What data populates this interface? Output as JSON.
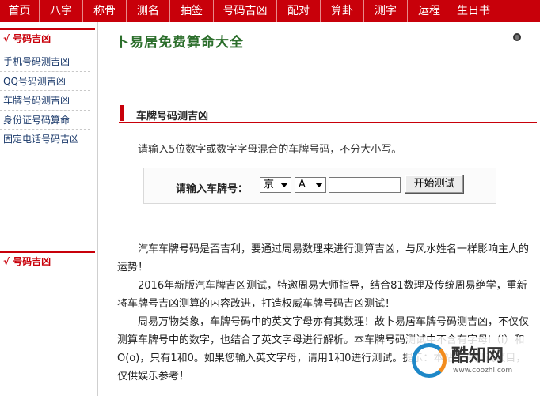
{
  "topnav": {
    "items": [
      "首页",
      "八字",
      "称骨",
      "测名",
      "抽签",
      "号码吉凶",
      "配对",
      "算卦",
      "测字",
      "运程",
      "生日书"
    ]
  },
  "sidebar": {
    "heading": "√ 号码吉凶",
    "items": [
      "手机号码测吉凶",
      "QQ号码测吉凶",
      "车牌号码测吉凶",
      "身份证号码算命",
      "固定电话号码吉凶"
    ],
    "second_heading": "√ 号码吉凶"
  },
  "main": {
    "site_title": "卜易居免费算命大全",
    "section_title": "车牌号码测吉凶",
    "instruction": "请输入5位数字或数字字母混合的车牌号码，不分大小写。",
    "form": {
      "label": "请输入车牌号：",
      "province_value": "京",
      "letter_value": "A",
      "plate_value": "",
      "button_label": "开始测试"
    },
    "paragraphs": [
      "汽车车牌号码是否吉利，要通过周易数理来进行测算吉凶，与风水姓名一样影响主人的运势！",
      "2016年新版汽车牌吉凶测试，特邀周易大师指导，结合81数理及传统周易绝学，重新将车牌号吉凶测算的内容改进，打造权威车牌号码吉凶测试！",
      "周易万物类象，车牌号码中的英文字母亦有其数理！故卜易居车牌号码测吉凶，不仅仅测算车牌号中的数字，也结合了英文字母进行解析。本车牌号码测试中不含有字母I（i）和O(o)，只有1和0。如果您输入英文字母，请用1和0进行测试。提示：本站所有测试项目，仅供娱乐参考！"
    ]
  },
  "watermark": {
    "name": "酷知网",
    "url": "www.coozhi.com"
  },
  "colors": {
    "brand_red": "#c8000a",
    "title_green": "#2b6e2b",
    "link_blue": "#1b3a6b"
  }
}
